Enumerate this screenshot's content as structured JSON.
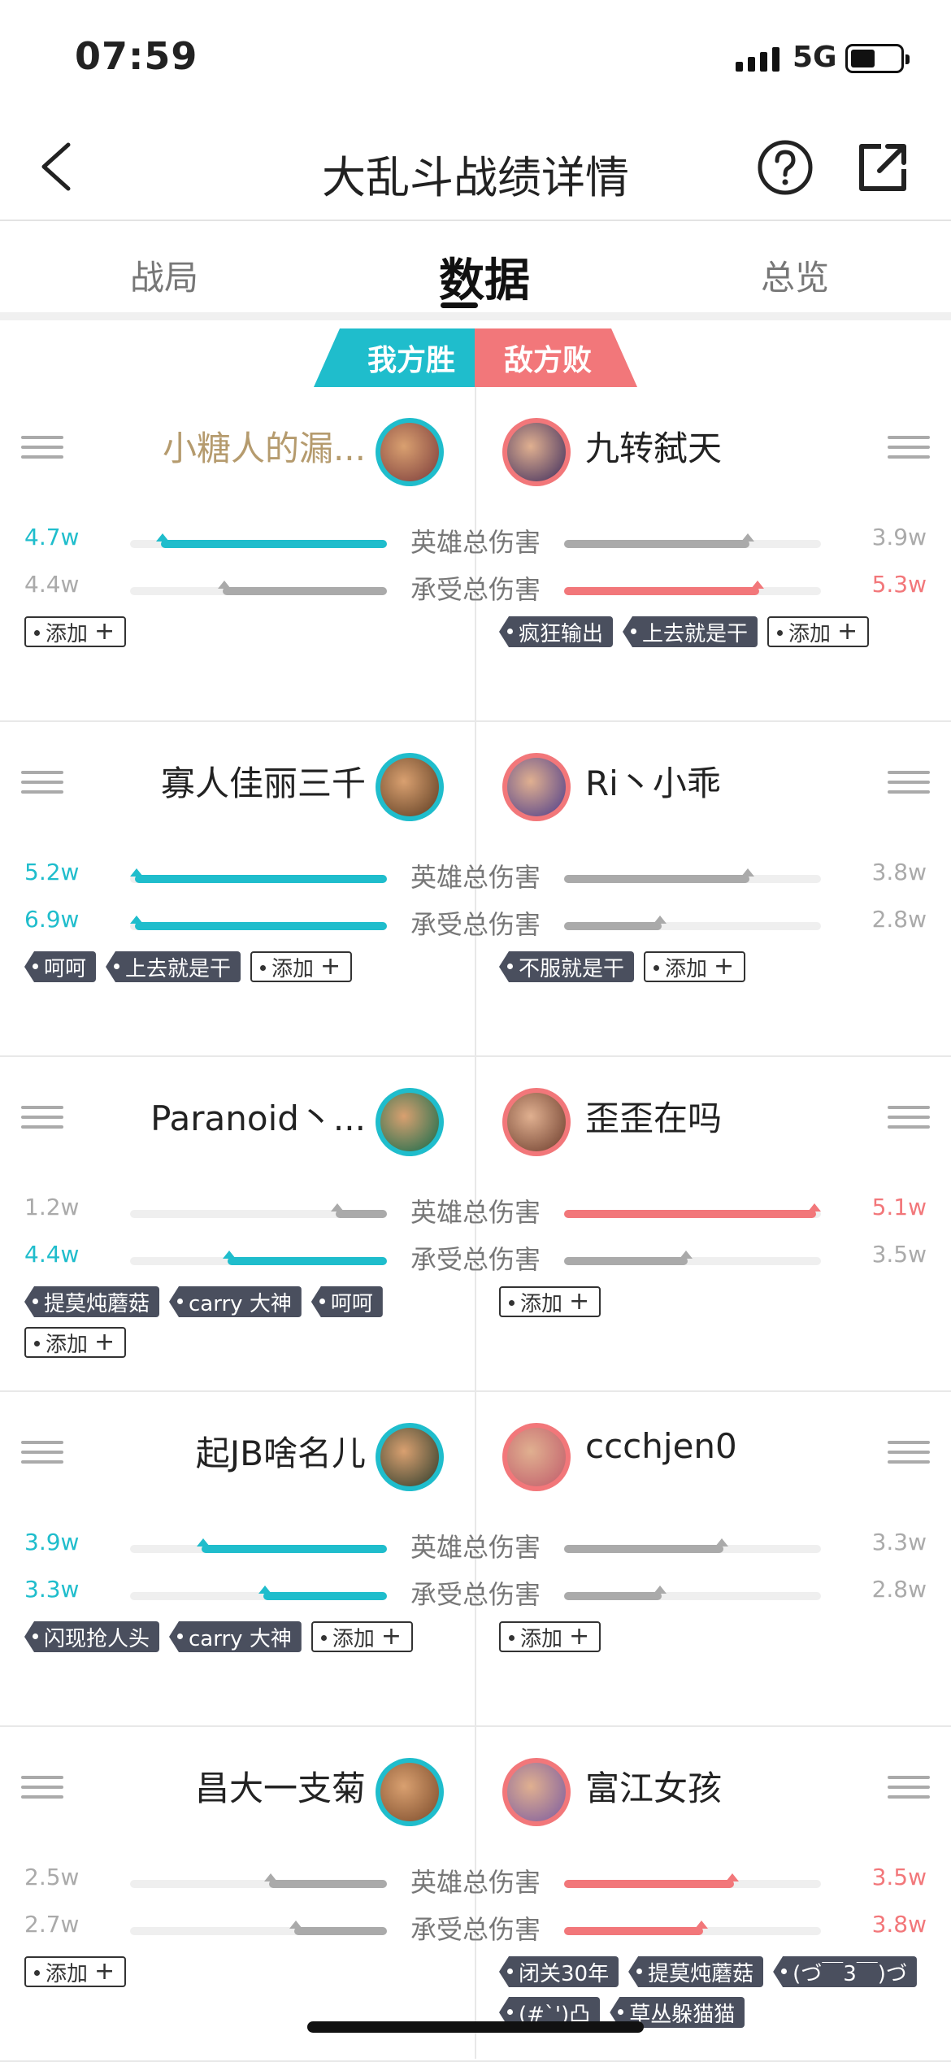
{
  "status": {
    "time": "07:59",
    "network": "5G"
  },
  "nav": {
    "title": "大乱斗战绩详情"
  },
  "tabs": [
    {
      "label": "战局",
      "active": false
    },
    {
      "label": "数据",
      "active": true
    },
    {
      "label": "总览",
      "active": false
    }
  ],
  "result": {
    "ours": "我方胜",
    "enemy": "敌方败"
  },
  "stat_labels": {
    "damage": "英雄总伤害",
    "taken": "承受总伤害"
  },
  "add_tag": "添加",
  "players": [
    {
      "left": {
        "name": "小糖人的漏...",
        "damage": "4.7w",
        "taken": "4.4w",
        "damage_fill": 0.88,
        "taken_fill": 0.64,
        "tags": []
      },
      "right": {
        "name": "九转弑天",
        "damage": "3.9w",
        "taken": "5.3w",
        "damage_fill": 0.72,
        "taken_fill": 0.76,
        "tags": [
          "疯狂输出",
          "上去就是干"
        ]
      }
    },
    {
      "left": {
        "name": "寡人佳丽三千",
        "damage": "5.2w",
        "taken": "6.9w",
        "damage_fill": 0.98,
        "taken_fill": 0.98,
        "tags": [
          "呵呵",
          "上去就是干"
        ]
      },
      "right": {
        "name": "Ri丶小乖",
        "damage": "3.8w",
        "taken": "2.8w",
        "damage_fill": 0.72,
        "taken_fill": 0.38,
        "tags": [
          "不服就是干"
        ]
      }
    },
    {
      "left": {
        "name": "Paranoid丶...",
        "damage": "1.2w",
        "taken": "4.4w",
        "damage_fill": 0.2,
        "taken_fill": 0.62,
        "tags": [
          "提莫炖蘑菇",
          "carry 大神",
          "呵呵"
        ]
      },
      "right": {
        "name": "歪歪在吗",
        "damage": "5.1w",
        "taken": "3.5w",
        "damage_fill": 0.98,
        "taken_fill": 0.48,
        "tags": []
      }
    },
    {
      "left": {
        "name": "起JB啥名儿",
        "damage": "3.9w",
        "taken": "3.3w",
        "damage_fill": 0.72,
        "taken_fill": 0.48,
        "tags": [
          "闪现抢人头",
          "carry 大神"
        ]
      },
      "right": {
        "name": "ccchjen0",
        "damage": "3.3w",
        "taken": "2.8w",
        "damage_fill": 0.62,
        "taken_fill": 0.38,
        "tags": []
      }
    },
    {
      "left": {
        "name": "昌大一支菊",
        "damage": "2.5w",
        "taken": "2.7w",
        "damage_fill": 0.46,
        "taken_fill": 0.36,
        "tags": []
      },
      "right": {
        "name": "富江女孩",
        "damage": "3.5w",
        "taken": "3.8w",
        "damage_fill": 0.66,
        "taken_fill": 0.54,
        "tags": [
          "闭关30年",
          "提莫炖蘑菇",
          "(づ￣3￣)づ",
          "(#`')凸",
          "草丛躲猫猫"
        ]
      }
    }
  ],
  "colors": {
    "teal": "#1fbdcc",
    "red": "#f2777a",
    "gray": "#aaaaaa",
    "gold": "#b59b6e"
  }
}
